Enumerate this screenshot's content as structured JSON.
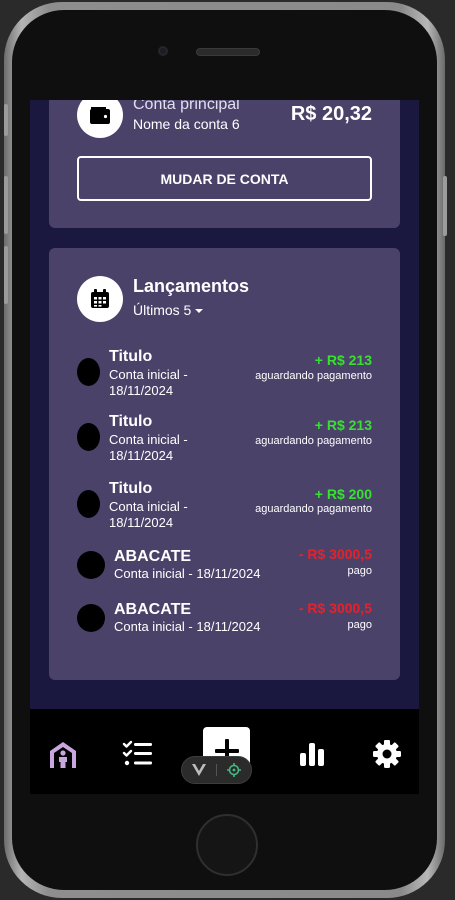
{
  "account": {
    "title": "Conta principal",
    "name": "Nome da conta 6",
    "balance": "R$ 20,32",
    "switch_label": "MUDAR DE CONTA"
  },
  "entries_section": {
    "title": "Lançamentos",
    "filter": "Últimos 5",
    "items": [
      {
        "name": "Titulo",
        "desc_line1": "Conta inicial -",
        "desc_line2": "18/11/2024",
        "amount": "+ R$ 213",
        "status": "aguardando pagamento"
      },
      {
        "name": "Titulo",
        "desc_line1": "Conta inicial -",
        "desc_line2": "18/11/2024",
        "amount": "+ R$ 213",
        "status": "aguardando pagamento"
      },
      {
        "name": "Titulo",
        "desc_line1": "Conta inicial -",
        "desc_line2": "18/11/2024",
        "amount": "+ R$ 200",
        "status": "aguardando pagamento"
      },
      {
        "name": "ABACATE",
        "desc": "Conta inicial - 18/11/2024",
        "amount": "- R$ 3000,5",
        "status": "pago"
      },
      {
        "name": "ABACATE",
        "desc": "Conta inicial - 18/11/2024",
        "amount": "- R$ 3000,5",
        "status": "pago"
      }
    ]
  },
  "tabbar": {
    "items": [
      {
        "icon": "home-person-icon"
      },
      {
        "icon": "checklist-icon"
      },
      {
        "icon": "plus-icon"
      },
      {
        "icon": "bar-chart-icon"
      },
      {
        "icon": "gear-icon"
      }
    ]
  },
  "colors": {
    "screen_bg": "#1b1840",
    "card_bg": "#4a4269",
    "positive": "#38e030",
    "negative": "#e2232e",
    "home_icon_accent": "#c9a6e0"
  }
}
